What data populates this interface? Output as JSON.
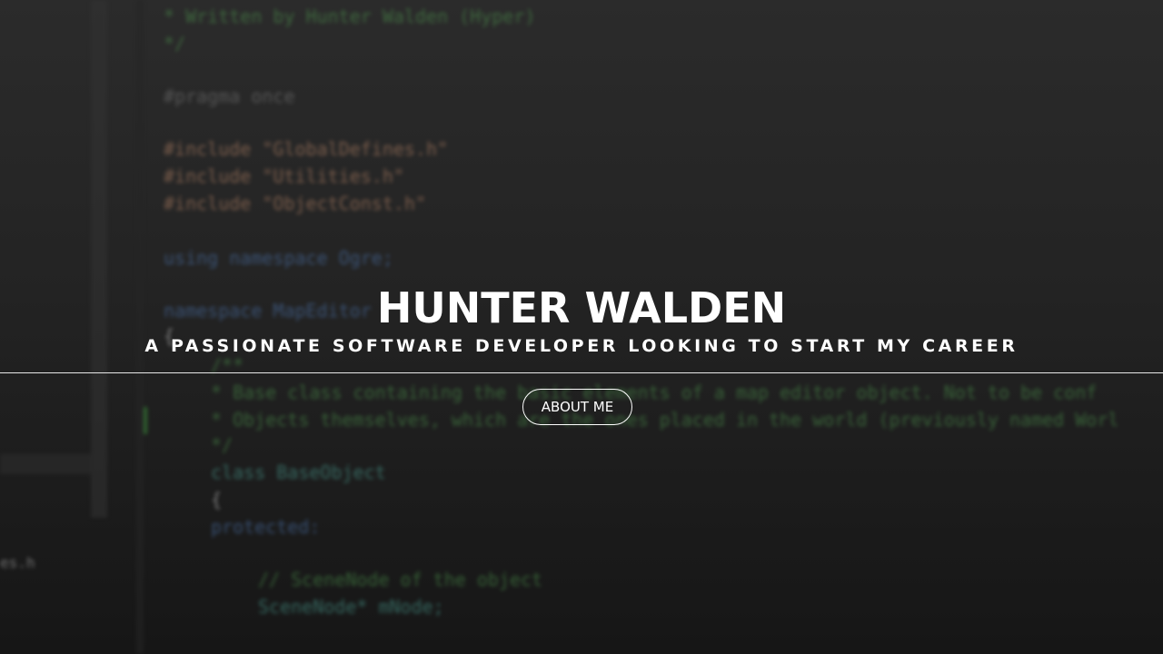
{
  "hero": {
    "name": "HUNTER WALDEN",
    "tagline": "A PASSIONATE SOFTWARE DEVELOPER LOOKING TO START MY CAREER",
    "about_button_label": "ABOUT ME"
  },
  "background_code": {
    "lines": [
      "* Written by Hunter Walden (Hyper)",
      "*/",
      "#pragma once",
      "#include \"GlobalDefines.h\"",
      "#include \"Utilities.h\"",
      "#include \"ObjectConst.h\"",
      "using namespace Ogre;",
      "namespace MapEditor",
      "{",
      "/**",
      "* Base class containing the basic elements of a map editor object. Not to be conf",
      "* Objects themselves, which are the ones placed in the world (previously named Worl",
      "*/",
      "class BaseObject",
      "{",
      "protected:",
      "// SceneNode of the object",
      "SceneNode* mNode;"
    ],
    "side_file_label": "es.h"
  },
  "colors": {
    "text": "#ffffff",
    "divider": "#e8e8e8",
    "background": "#1f1f1f"
  }
}
